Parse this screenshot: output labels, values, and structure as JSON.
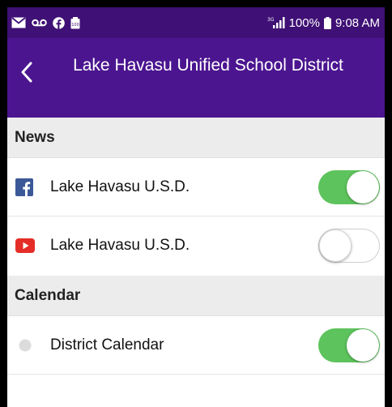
{
  "status_bar": {
    "network": "3G",
    "battery_percent": "100%",
    "time": "9:08 AM",
    "left_icons": [
      "mail-icon",
      "voicemail-icon",
      "facebook-icon",
      "notification-icon"
    ]
  },
  "header": {
    "title": "Lake Havasu Unified School District",
    "background": "#4b1590"
  },
  "sections": [
    {
      "label": "News",
      "items": [
        {
          "label": "Lake Havasu U.S.D.",
          "icon": "facebook-icon",
          "enabled": true
        },
        {
          "label": "Lake Havasu U.S.D.",
          "icon": "youtube-icon",
          "enabled": false
        }
      ]
    },
    {
      "label": "Calendar",
      "items": [
        {
          "label": "District Calendar",
          "icon": "calendar-dot-icon",
          "enabled": true
        }
      ]
    }
  ],
  "colors": {
    "toggle_on": "#5dc35c",
    "facebook": "#3b5998",
    "youtube": "#e52d27",
    "section_bg": "#ececec"
  }
}
